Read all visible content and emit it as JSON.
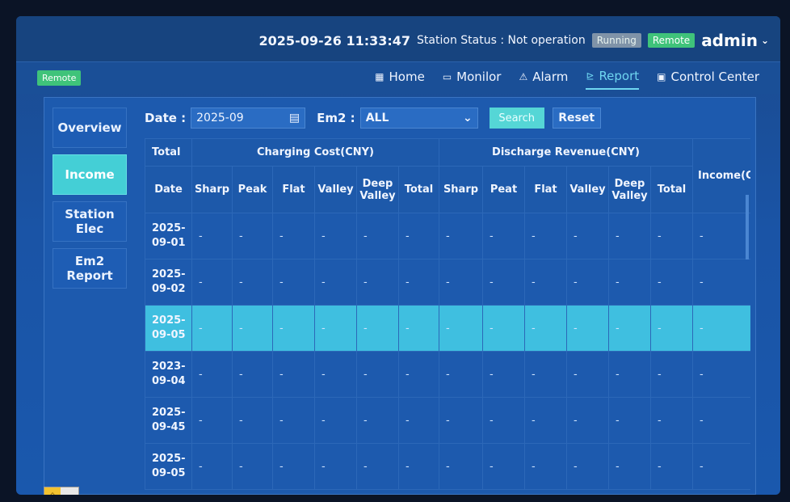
{
  "header": {
    "datetime": "2025-09-26 11:33:47",
    "status_label": "Station Status : Not operation",
    "running_badge": "Running",
    "remote_badge": "Remote",
    "user": "admin"
  },
  "nav": {
    "remote_label": "Remote",
    "items": [
      {
        "icon": "home-icon",
        "glyph": "▦",
        "label": "Home"
      },
      {
        "icon": "monitor-icon",
        "glyph": "▭",
        "label": "Monilor"
      },
      {
        "icon": "alarm-icon",
        "glyph": "⚠",
        "label": "Alarm"
      },
      {
        "icon": "report-icon",
        "glyph": "⊵",
        "label": "Report",
        "active": true
      },
      {
        "icon": "control-center-icon",
        "glyph": "▣",
        "label": "Control Center"
      }
    ]
  },
  "sidebar": {
    "items": [
      {
        "label": "Overview"
      },
      {
        "label": "Income",
        "active": true
      },
      {
        "label": "Station Elec"
      },
      {
        "label": "Em2 Report"
      }
    ]
  },
  "filters": {
    "date_label": "Date :",
    "date_value": "2025-09",
    "em2_label": "Em2 :",
    "em2_value": "ALL",
    "search_label": "Search",
    "reset_label": "Reset"
  },
  "table": {
    "group_headers": {
      "total": "Total",
      "charging": "Charging Cost(CNY)",
      "discharge": "Discharge Revenue(CNY)",
      "income": "Income(CNY)"
    },
    "columns": [
      "Date",
      "Sharp",
      "Peak",
      "Flat",
      "Valley",
      "Deep Valley",
      "Total",
      "Sharp",
      "Peat",
      "Flat",
      "Valley",
      "Deep Valley",
      "Total"
    ],
    "rows": [
      {
        "date": "2025-09-01",
        "cells": [
          "-",
          "-",
          "-",
          "-",
          "-",
          "-",
          "-",
          "-",
          "-",
          "-",
          "-",
          "-",
          "-"
        ]
      },
      {
        "date": "2025-09-02",
        "cells": [
          "-",
          "-",
          "-",
          "-",
          "-",
          "-",
          "-",
          "-",
          "-",
          "-",
          "-",
          "-",
          "-"
        ]
      },
      {
        "date": "2025-09-05",
        "cells": [
          "-",
          "-",
          "-",
          "-",
          "-",
          "-",
          "-",
          "-",
          "-",
          "-",
          "-",
          "-",
          "-"
        ],
        "selected": true
      },
      {
        "date": "2023-09-04",
        "cells": [
          "-",
          "-",
          "-",
          "-",
          "-",
          "-",
          "-",
          "-",
          "-",
          "-",
          "-",
          "-",
          "-"
        ]
      },
      {
        "date": "2025-09-45",
        "cells": [
          "-",
          "-",
          "-",
          "-",
          "-",
          "-",
          "-",
          "-",
          "-",
          "-",
          "-",
          "-",
          "-"
        ]
      },
      {
        "date": "2025-09-05",
        "cells": [
          "-",
          "-",
          "-",
          "-",
          "-",
          "-",
          "-",
          "-",
          "-",
          "-",
          "-",
          "-",
          "-"
        ]
      }
    ]
  }
}
